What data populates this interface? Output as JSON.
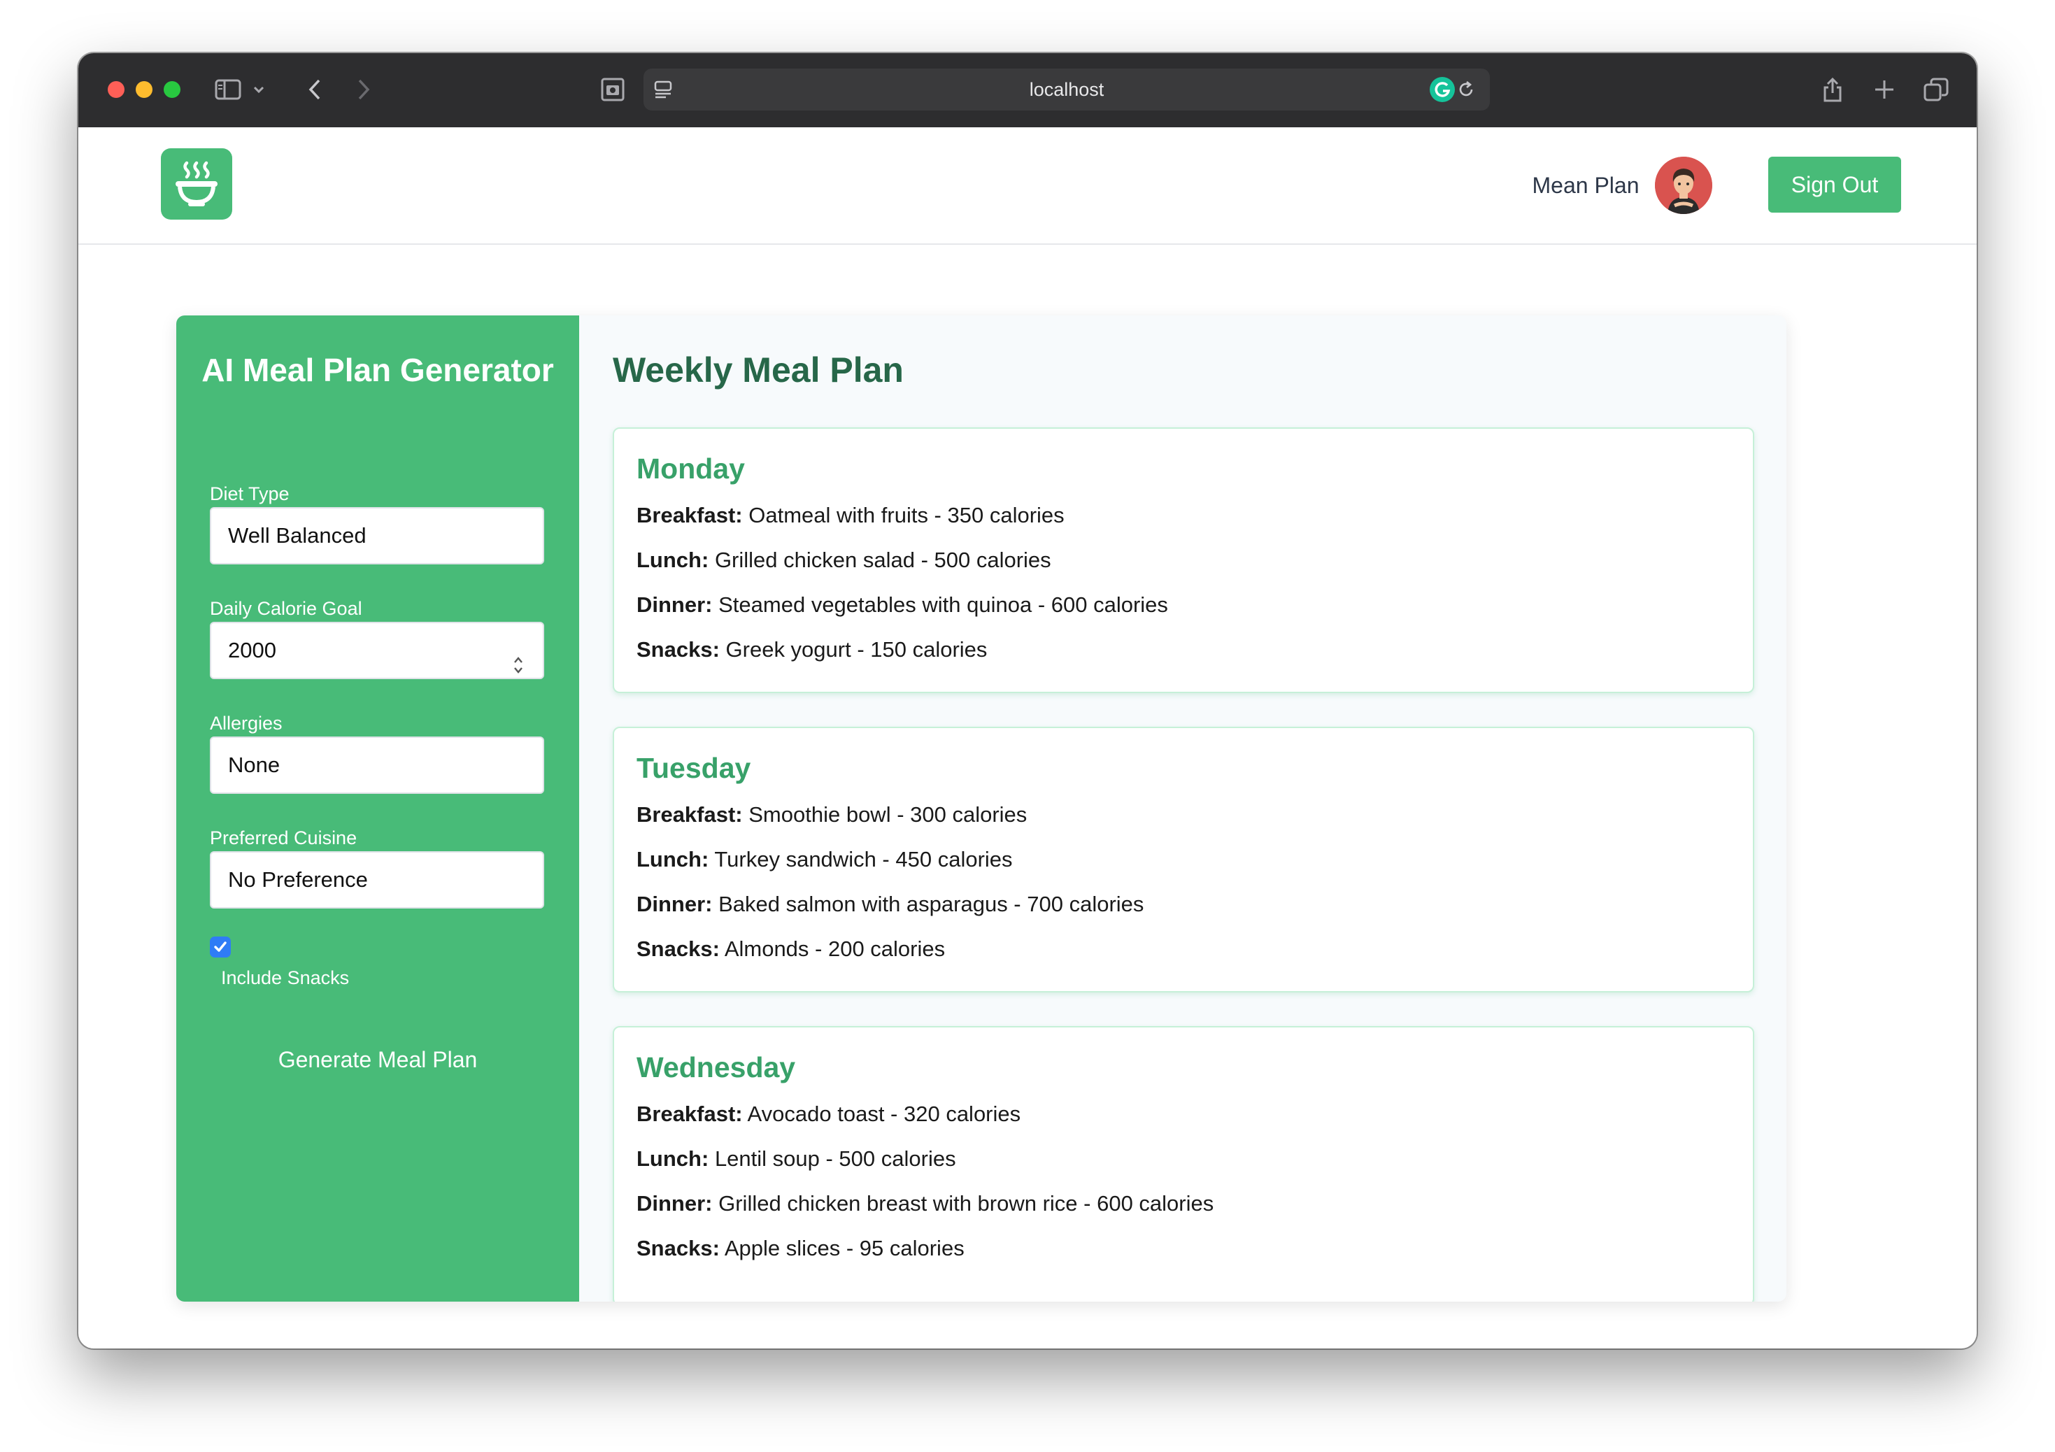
{
  "browser": {
    "url": "localhost"
  },
  "header": {
    "nav_link": "Mean Plan",
    "sign_out": "Sign Out"
  },
  "form": {
    "title": "AI Meal Plan Generator",
    "diet_type": {
      "label": "Diet Type",
      "value": "Well Balanced"
    },
    "calorie_goal": {
      "label": "Daily Calorie Goal",
      "value": "2000"
    },
    "allergies": {
      "label": "Allergies",
      "value": "None"
    },
    "cuisine": {
      "label": "Preferred Cuisine",
      "value": "No Preference"
    },
    "include_snacks": {
      "label": "Include Snacks",
      "checked": true
    },
    "generate_button": "Generate Meal Plan"
  },
  "plan": {
    "title": "Weekly Meal Plan",
    "days": [
      {
        "name": "Monday",
        "meals": [
          {
            "label": "Breakfast:",
            "text": "Oatmeal with fruits - 350 calories"
          },
          {
            "label": "Lunch:",
            "text": "Grilled chicken salad - 500 calories"
          },
          {
            "label": "Dinner:",
            "text": "Steamed vegetables with quinoa - 600 calories"
          },
          {
            "label": "Snacks:",
            "text": "Greek yogurt - 150 calories"
          }
        ]
      },
      {
        "name": "Tuesday",
        "meals": [
          {
            "label": "Breakfast:",
            "text": "Smoothie bowl - 300 calories"
          },
          {
            "label": "Lunch:",
            "text": "Turkey sandwich - 450 calories"
          },
          {
            "label": "Dinner:",
            "text": "Baked salmon with asparagus - 700 calories"
          },
          {
            "label": "Snacks:",
            "text": "Almonds - 200 calories"
          }
        ]
      },
      {
        "name": "Wednesday",
        "meals": [
          {
            "label": "Breakfast:",
            "text": "Avocado toast - 320 calories"
          },
          {
            "label": "Lunch:",
            "text": "Lentil soup - 500 calories"
          },
          {
            "label": "Dinner:",
            "text": "Grilled chicken breast with brown rice - 600 calories"
          },
          {
            "label": "Snacks:",
            "text": "Apple slices - 95 calories"
          }
        ]
      }
    ]
  },
  "colors": {
    "brand_green": "#48bb78",
    "heading_green": "#276749",
    "day_green": "#38a169",
    "checkbox_blue": "#2f7cf6"
  },
  "icons": [
    "close-light",
    "minimize-light",
    "zoom-light",
    "sidebar-icon",
    "chevron-down-icon",
    "back-icon",
    "forward-icon",
    "screenshot-icon",
    "page-menu-icon",
    "reload-icon",
    "grammarly-icon",
    "share-icon",
    "new-tab-icon",
    "tabs-overview-icon",
    "steaming-bowl-logo-icon",
    "user-avatar"
  ]
}
